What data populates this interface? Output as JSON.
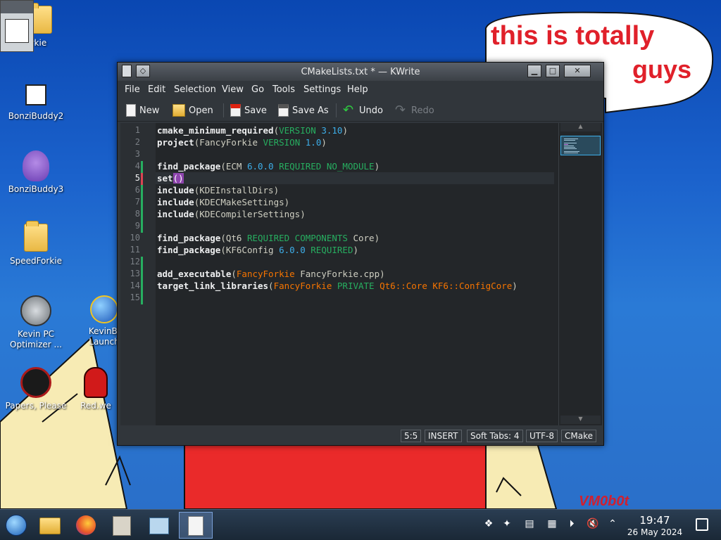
{
  "desktop": {
    "icons": [
      {
        "label": "Forkie"
      },
      {
        "label": "BonziBuddy2"
      },
      {
        "label": "BonziBuddy3"
      },
      {
        "label": "SpeedForkie"
      },
      {
        "label": "Kevin PC Optimizer ..."
      },
      {
        "label": "KevinBl Launch"
      },
      {
        "label": "Papers, Please"
      },
      {
        "label": "Red.we"
      }
    ],
    "bubble_text_1": "this is totally",
    "bubble_text_2": "guys",
    "watermark": "VM0b0t"
  },
  "window": {
    "title": "CMakeLists.txt * — KWrite",
    "menu": [
      {
        "label": "File"
      },
      {
        "label": "Edit"
      },
      {
        "label": "Selection"
      },
      {
        "label": "View"
      },
      {
        "label": "Go"
      },
      {
        "label": "Tools"
      },
      {
        "label": "Settings"
      },
      {
        "label": "Help"
      }
    ],
    "toolbar": {
      "new": "New",
      "open": "Open",
      "save": "Save",
      "save_as": "Save As",
      "undo": "Undo",
      "redo": "Redo"
    },
    "line_numbers": [
      "1",
      "2",
      "3",
      "4",
      "5",
      "6",
      "7",
      "8",
      "9",
      "10",
      "11",
      "12",
      "13",
      "14",
      "15"
    ],
    "current_line": 5,
    "status": {
      "cursor": "5:5",
      "mode": "INSERT",
      "tabs": "Soft Tabs: 4",
      "encoding": "UTF-8",
      "syntax": "CMake"
    }
  },
  "code": {
    "l1": {
      "fn": "cmake_minimum_required",
      "a": "VERSION",
      "b": "3.10"
    },
    "l2": {
      "fn": "project",
      "a": "FancyForkie",
      "b": "VERSION",
      "c": "1.0"
    },
    "l4": {
      "fn": "find_package",
      "a": "ECM",
      "b": "6.0.0",
      "c": "REQUIRED NO_MODULE"
    },
    "l5": {
      "fn": "set",
      "a": "()"
    },
    "l6": {
      "fn": "include",
      "a": "KDEInstallDirs"
    },
    "l7": {
      "fn": "include",
      "a": "KDECMakeSettings"
    },
    "l8": {
      "fn": "include",
      "a": "KDECompilerSettings"
    },
    "l10": {
      "fn": "find_package",
      "a": "Qt6",
      "b": "REQUIRED COMPONENTS",
      "c": "Core"
    },
    "l11": {
      "fn": "find_package",
      "a": "KF6Config",
      "b": "6.0.0",
      "c": "REQUIRED"
    },
    "l13": {
      "fn": "add_executable",
      "a": "FancyForkie",
      "b": "FancyForkie.cpp"
    },
    "l14": {
      "fn": "target_link_libraries",
      "a": "FancyForkie",
      "b": "PRIVATE",
      "c": "Qt6::Core KF6::ConfigCore"
    }
  },
  "taskbar": {
    "time": "19:47",
    "date": "26 May 2024"
  },
  "colors": {
    "keyword": "#eff0f1",
    "green": "#27ae60",
    "number": "#3daee9",
    "orange": "#f67400",
    "bracket_highlight": "#8e44ad"
  }
}
